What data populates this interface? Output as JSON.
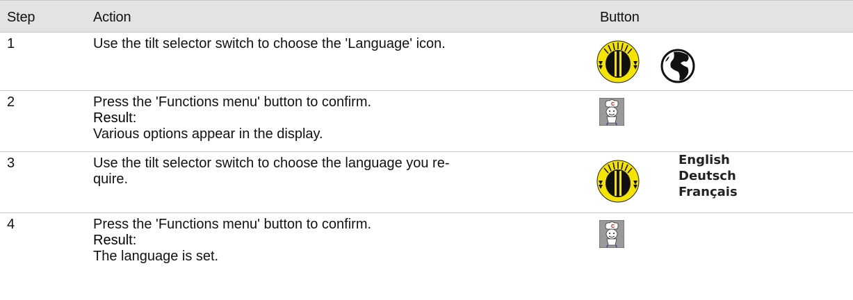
{
  "table": {
    "headers": {
      "step": "Step",
      "action": "Action",
      "button": "Button"
    },
    "rows": [
      {
        "step": "1",
        "action_line1": "Use the tilt selector switch to choose the 'Language' icon."
      },
      {
        "step": "2",
        "action_line1": "Press the 'Functions menu' button to confirm.",
        "result_label": "Result:",
        "result_text": "Various options appear in the display."
      },
      {
        "step": "3",
        "action_line1": "Use the tilt selector switch to choose the language you re-",
        "action_line2": "quire.",
        "languages": [
          "English",
          "Deutsch",
          "Français"
        ]
      },
      {
        "step": "4",
        "action_line1": "Press the 'Functions menu' button to confirm.",
        "result_label": "Result:",
        "result_text": "The language is set."
      }
    ]
  },
  "icons": {
    "dial": "tilt-selector-dial-icon",
    "globe": "language-globe-icon",
    "chef": "functions-menu-chef-icon"
  },
  "colors": {
    "header_bg": "#e3e3e3",
    "dial_yellow": "#f5e400",
    "chef_bg": "#9a9a9a"
  }
}
